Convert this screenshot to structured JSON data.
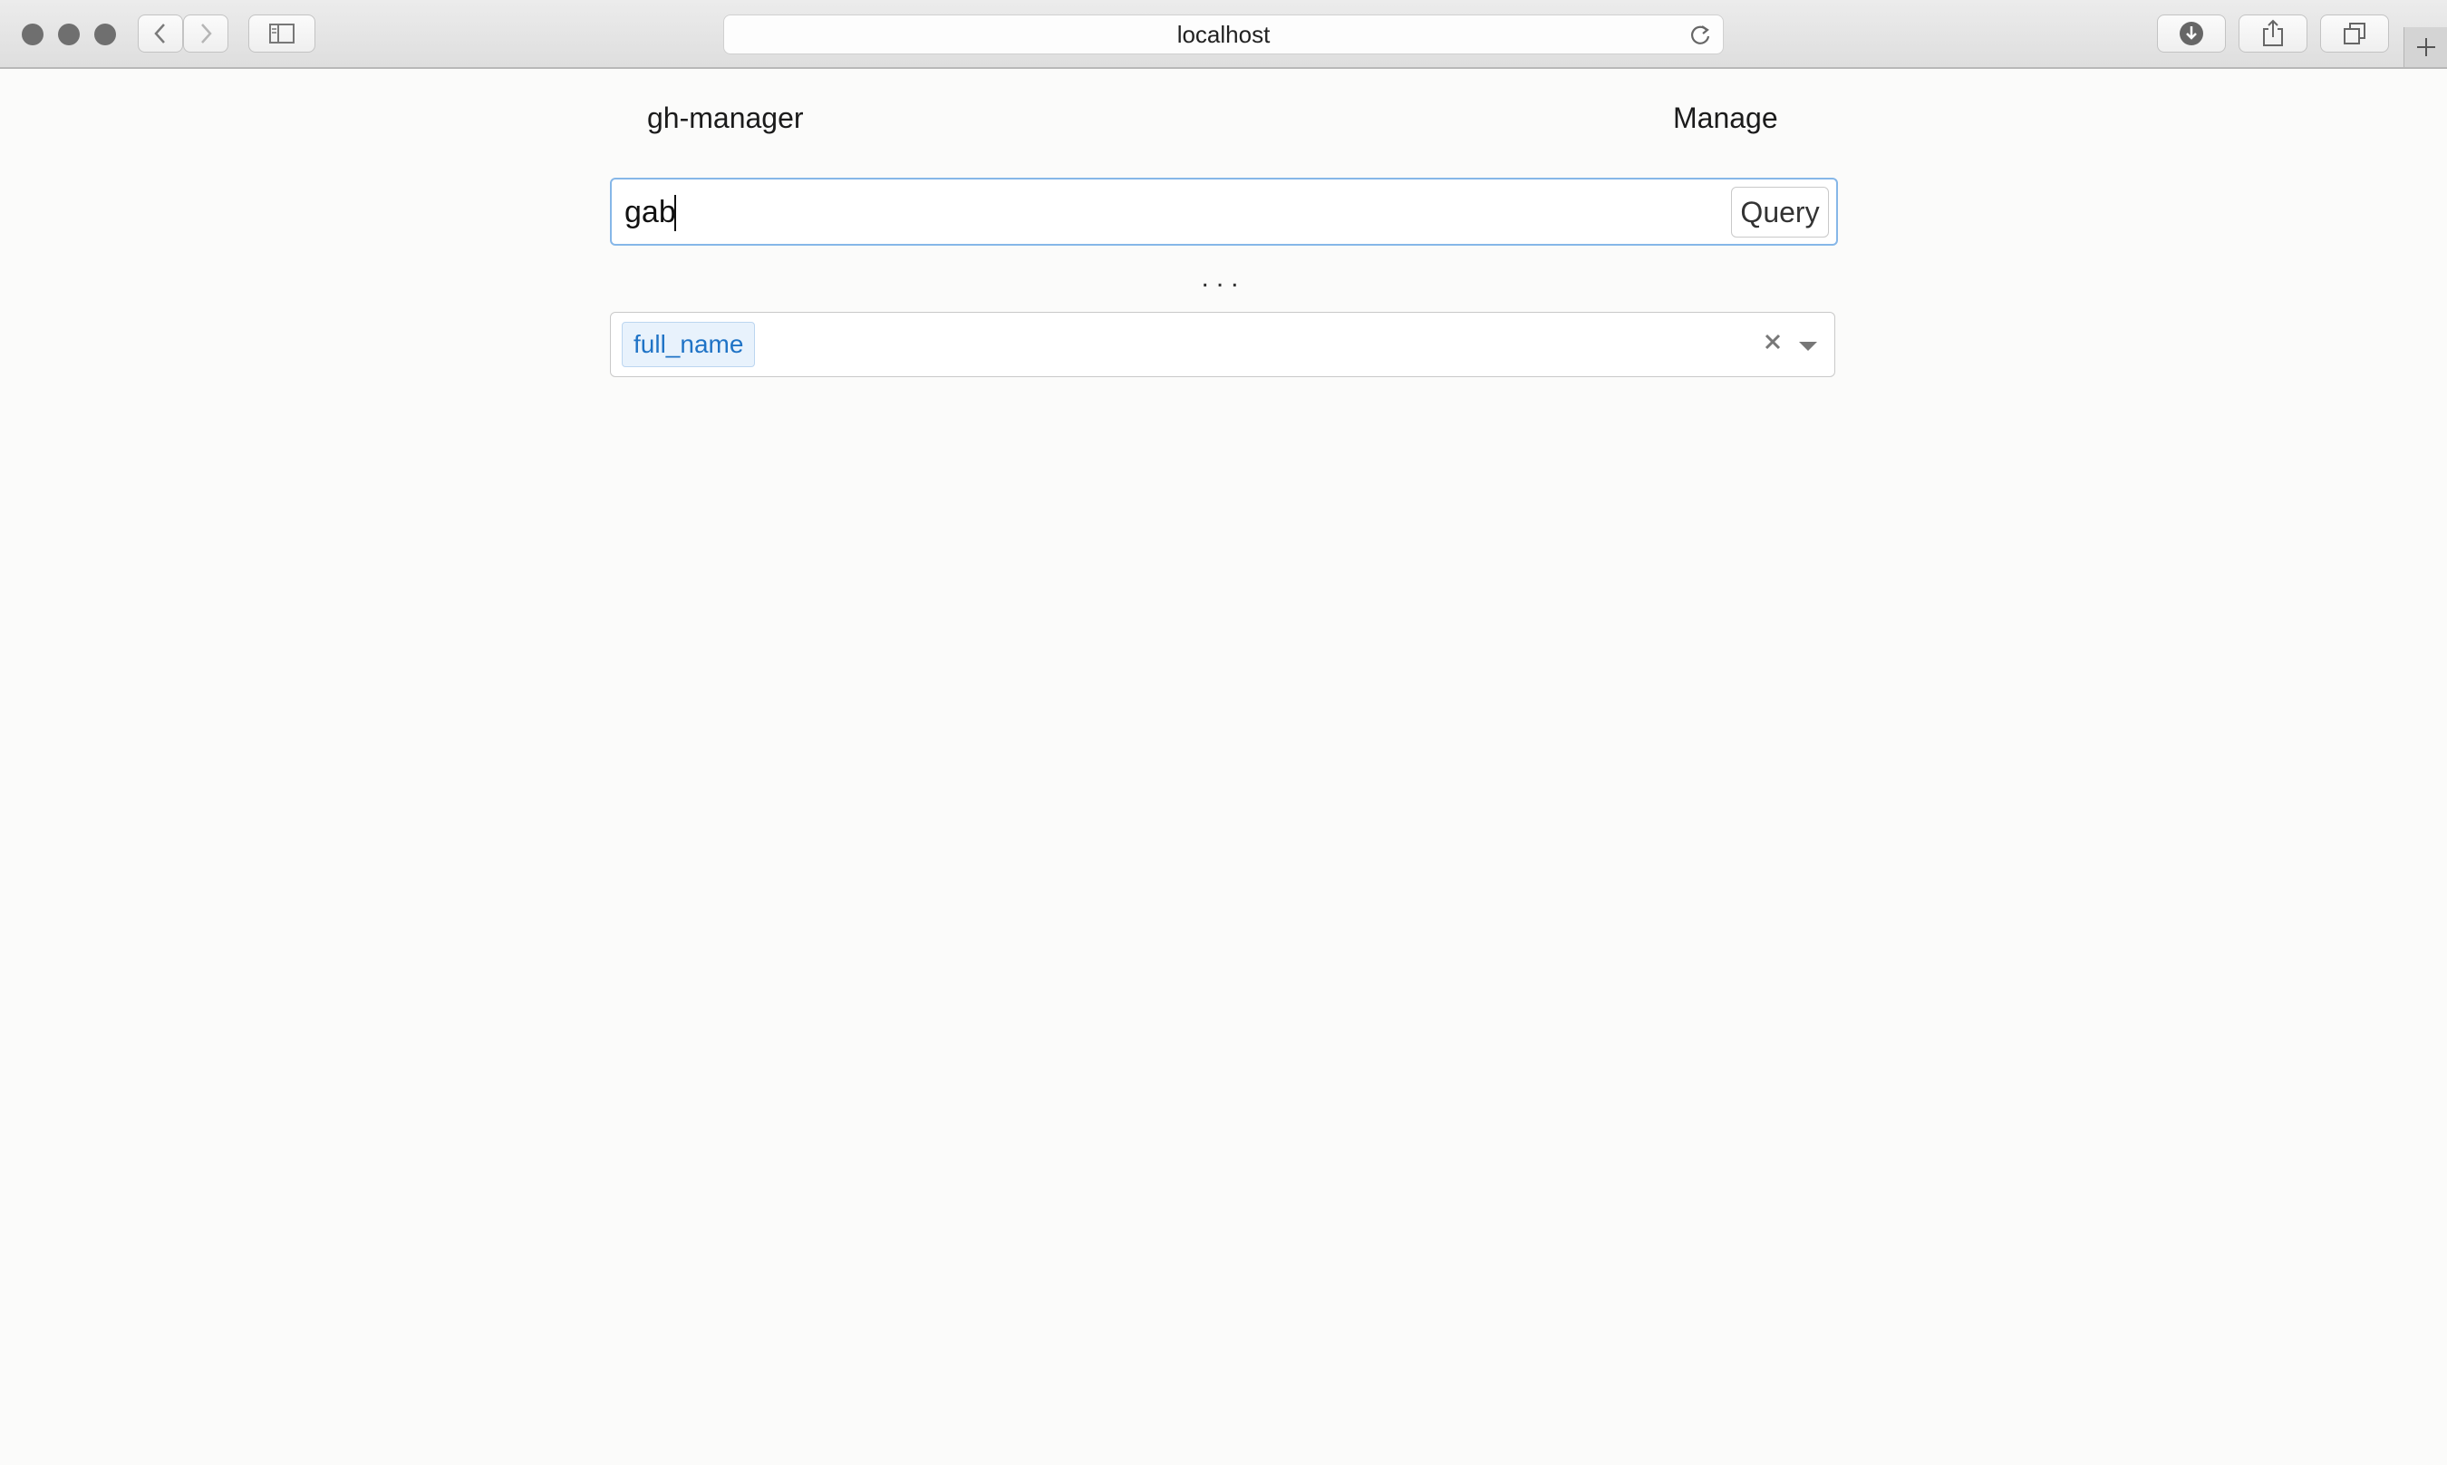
{
  "browser": {
    "url": "localhost",
    "icons": {
      "back": "chevron-left-icon",
      "forward": "chevron-right-icon",
      "sidebar": "sidebar-icon",
      "reload": "reload-icon",
      "downloads": "download-icon",
      "share": "share-icon",
      "tabs": "tabs-icon",
      "new_tab": "plus-icon"
    }
  },
  "header": {
    "brand": "gh-manager",
    "nav_link": "Manage"
  },
  "search": {
    "value": "gab",
    "button_label": "Query"
  },
  "loading_indicator": "...",
  "field_selector": {
    "selected_tags": [
      "full_name"
    ]
  },
  "colors": {
    "accent": "#1f73c6",
    "input_focus_border": "#86b7e8",
    "tag_background": "#e8f2fc"
  }
}
